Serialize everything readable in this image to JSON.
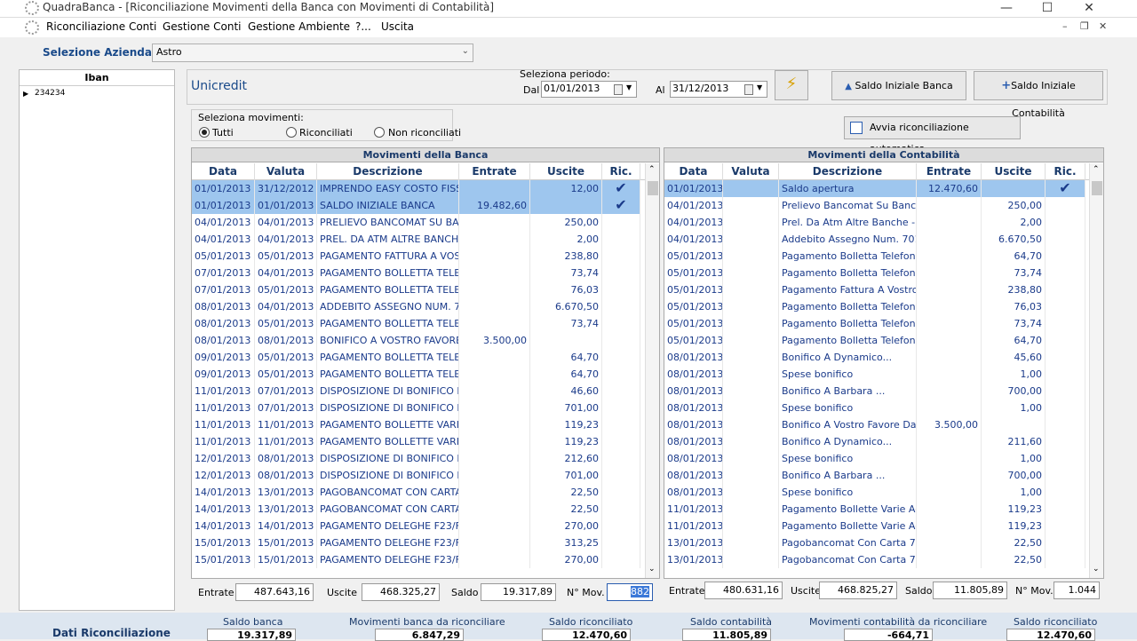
{
  "window": {
    "title": "QuadraBanca - [Riconciliazione Movimenti della Banca con Movimenti di Contabilità]"
  },
  "menu": [
    "Riconciliazione Conti",
    "Gestione Conti",
    "Gestione Ambiente",
    "?...",
    "Uscita"
  ],
  "azienda": {
    "label": "Selezione Azienda",
    "value": "Astro"
  },
  "iban": {
    "header": "Iban",
    "rows": [
      "234234"
    ]
  },
  "header": {
    "bank": "Unicredit",
    "period_label": "Seleziona periodo:",
    "dal_label": "Dal",
    "dal": "01/01/2013",
    "al_label": "Al",
    "al": "31/12/2013",
    "saldo_banca_btn": "Saldo Iniziale Banca",
    "saldo_cont_btn": "Saldo Iniziale Contabilità"
  },
  "movsel": {
    "label": "Seleziona movimenti:",
    "options": [
      "Tutti",
      "Riconciliati",
      "Non riconciliati"
    ],
    "selected": "Tutti"
  },
  "auto_btn": "Avvia riconciliazione automatica",
  "bank": {
    "title": "Movimenti della Banca",
    "columns": [
      "Data",
      "Valuta",
      "Descrizione",
      "Entrate",
      "Uscite",
      "Ric."
    ],
    "rows": [
      [
        "01/01/2013",
        "31/12/2012",
        "IMPRENDO EASY COSTO FISSO",
        "",
        "12,00",
        true
      ],
      [
        "01/01/2013",
        "01/01/2013",
        "SALDO INIZIALE BANCA",
        "19.482,60",
        "",
        true
      ],
      [
        "04/01/2013",
        "04/01/2013",
        "PRELIEVO BANCOMAT SU BANCA",
        "",
        "250,00",
        false
      ],
      [
        "04/01/2013",
        "04/01/2013",
        "PREL. DA ATM ALTRE BANCHE",
        "",
        "2,00",
        false
      ],
      [
        "05/01/2013",
        "05/01/2013",
        "PAGAMENTO FATTURA A VOSTRO",
        "",
        "238,80",
        false
      ],
      [
        "07/01/2013",
        "04/01/2013",
        "PAGAMENTO BOLLETTA TELEFONICA",
        "",
        "73,74",
        false
      ],
      [
        "07/01/2013",
        "05/01/2013",
        "PAGAMENTO BOLLETTA TELEFONICA",
        "",
        "76,03",
        false
      ],
      [
        "08/01/2013",
        "04/01/2013",
        "ADDEBITO ASSEGNO NUM. 7019",
        "",
        "6.670,50",
        false
      ],
      [
        "08/01/2013",
        "05/01/2013",
        "PAGAMENTO BOLLETTA TELEFONICA",
        "",
        "73,74",
        false
      ],
      [
        "08/01/2013",
        "08/01/2013",
        "BONIFICO A VOSTRO FAVORE",
        "3.500,00",
        "",
        false
      ],
      [
        "09/01/2013",
        "05/01/2013",
        "PAGAMENTO BOLLETTA TELEFONICA",
        "",
        "64,70",
        false
      ],
      [
        "09/01/2013",
        "05/01/2013",
        "PAGAMENTO BOLLETTA TELEFONICA",
        "",
        "64,70",
        false
      ],
      [
        "11/01/2013",
        "07/01/2013",
        "DISPOSIZIONE DI BONIFICO B",
        "",
        "46,60",
        false
      ],
      [
        "11/01/2013",
        "07/01/2013",
        "DISPOSIZIONE DI BONIFICO B",
        "",
        "701,00",
        false
      ],
      [
        "11/01/2013",
        "11/01/2013",
        "PAGAMENTO BOLLETTE VARIE",
        "",
        "119,23",
        false
      ],
      [
        "11/01/2013",
        "11/01/2013",
        "PAGAMENTO BOLLETTE VARIE",
        "",
        "119,23",
        false
      ],
      [
        "12/01/2013",
        "08/01/2013",
        "DISPOSIZIONE DI BONIFICO B",
        "",
        "212,60",
        false
      ],
      [
        "12/01/2013",
        "08/01/2013",
        "DISPOSIZIONE DI BONIFICO B",
        "",
        "701,00",
        false
      ],
      [
        "14/01/2013",
        "13/01/2013",
        "PAGOBANCOMAT CON CARTA",
        "",
        "22,50",
        false
      ],
      [
        "14/01/2013",
        "13/01/2013",
        "PAGOBANCOMAT CON CARTA",
        "",
        "22,50",
        false
      ],
      [
        "14/01/2013",
        "14/01/2013",
        "PAGAMENTO DELEGHE F23/F24",
        "",
        "270,00",
        false
      ],
      [
        "15/01/2013",
        "15/01/2013",
        "PAGAMENTO DELEGHE F23/F24",
        "",
        "313,25",
        false
      ],
      [
        "15/01/2013",
        "15/01/2013",
        "PAGAMENTO DELEGHE F23/F24",
        "",
        "270,00",
        false
      ]
    ],
    "footer": {
      "entrate_label": "Entrate",
      "entrate": "487.643,16",
      "uscite_label": "Uscite",
      "uscite": "468.325,27",
      "saldo_label": "Saldo",
      "saldo": "19.317,89",
      "nmov_label": "N° Mov.",
      "nmov": "882"
    }
  },
  "cont": {
    "title": "Movimenti della Contabilità",
    "columns": [
      "Data",
      "Valuta",
      "Descrizione",
      "Entrate",
      "Uscite",
      "Ric."
    ],
    "rows": [
      [
        "01/01/2013",
        "",
        "Saldo apertura",
        "12.470,60",
        "",
        true
      ],
      [
        "04/01/2013",
        "",
        "Prelievo Bancomat Su Banca 1",
        "",
        "250,00",
        false
      ],
      [
        "04/01/2013",
        "",
        "Prel. Da Atm Altre Banche - Sp",
        "",
        "2,00",
        false
      ],
      [
        "04/01/2013",
        "",
        "Addebito Assegno Num. 7019",
        "",
        "6.670,50",
        false
      ],
      [
        "05/01/2013",
        "",
        "Pagamento Bolletta Telefonica",
        "",
        "64,70",
        false
      ],
      [
        "05/01/2013",
        "",
        "Pagamento Bolletta Telefonica",
        "",
        "73,74",
        false
      ],
      [
        "05/01/2013",
        "",
        "Pagamento Fattura A Vostro",
        "",
        "238,80",
        false
      ],
      [
        "05/01/2013",
        "",
        "Pagamento Bolletta Telefonica",
        "",
        "76,03",
        false
      ],
      [
        "05/01/2013",
        "",
        "Pagamento Bolletta Telefonica",
        "",
        "73,74",
        false
      ],
      [
        "05/01/2013",
        "",
        "Pagamento Bolletta Telefonica",
        "",
        "64,70",
        false
      ],
      [
        "08/01/2013",
        "",
        "Bonifico A Dynamico...",
        "",
        "45,60",
        false
      ],
      [
        "08/01/2013",
        "",
        "Spese bonifico",
        "",
        "1,00",
        false
      ],
      [
        "08/01/2013",
        "",
        "Bonifico A Barbara ...",
        "",
        "700,00",
        false
      ],
      [
        "08/01/2013",
        "",
        "Spese bonifico",
        "",
        "1,00",
        false
      ],
      [
        "08/01/2013",
        "",
        "Bonifico A Vostro Favore Da C",
        "3.500,00",
        "",
        false
      ],
      [
        "08/01/2013",
        "",
        "Bonifico A Dynamico...",
        "",
        "211,60",
        false
      ],
      [
        "08/01/2013",
        "",
        "Spese bonifico",
        "",
        "1,00",
        false
      ],
      [
        "08/01/2013",
        "",
        "Bonifico A Barbara ...",
        "",
        "700,00",
        false
      ],
      [
        "08/01/2013",
        "",
        "Spese bonifico",
        "",
        "1,00",
        false
      ],
      [
        "11/01/2013",
        "",
        "Pagamento Bollette Varie Ace",
        "",
        "119,23",
        false
      ],
      [
        "11/01/2013",
        "",
        "Pagamento Bollette Varie Ace",
        "",
        "119,23",
        false
      ],
      [
        "13/01/2013",
        "",
        "Pagobancomat Con Carta 756",
        "",
        "22,50",
        false
      ],
      [
        "13/01/2013",
        "",
        "Pagobancomat Con Carta 756",
        "",
        "22,50",
        false
      ]
    ],
    "footer": {
      "entrate_label": "Entrate",
      "entrate": "480.631,16",
      "uscite_label": "Uscite",
      "uscite": "468.825,27",
      "saldo_label": "Saldo",
      "saldo": "11.805,89",
      "nmov_label": "N° Mov.",
      "nmov": "1.044"
    }
  },
  "riepilogo": {
    "title": "Dati Riconciliazione",
    "saldo_banca_label": "Saldo banca",
    "saldo_banca": "19.317,89",
    "mov_banca_label": "Movimenti banca da riconciliare",
    "mov_banca": "6.847,29",
    "saldo_ric_label": "Saldo riconciliato",
    "saldo_ric": "12.470,60",
    "saldo_cont_label": "Saldo contabilità",
    "saldo_cont": "11.805,89",
    "mov_cont_label": "Movimenti contabilità da riconciliare",
    "mov_cont": "-664,71",
    "saldo_ric2_label": "Saldo riconciliato",
    "saldo_ric2": "12.470,60"
  },
  "colors": {
    "selected_row": "#9ec6ee",
    "text_blue": "#1a3a8a"
  }
}
